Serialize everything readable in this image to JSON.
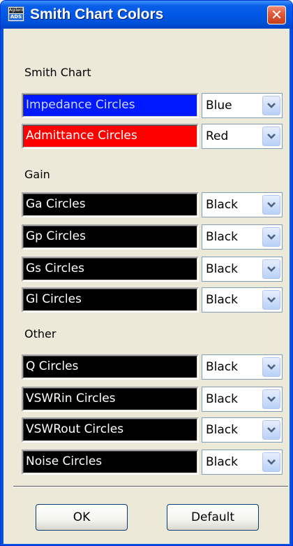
{
  "window": {
    "title": "Smith Chart Colors",
    "icon_top_text": "Agilent",
    "icon_bottom_text": "ADS",
    "close_glyph": "✕"
  },
  "sections": {
    "smith_chart": "Smith Chart",
    "gain": "Gain",
    "other": "Other"
  },
  "rows": [
    {
      "label": "Impedance Circles",
      "value": "Blue",
      "swatch_color": "#0019ff",
      "text_color": "#cfd8ff"
    },
    {
      "label": "Admittance Circles",
      "value": "Red",
      "swatch_color": "#ff0000",
      "text_color": "#ffffff"
    },
    {
      "label": "Ga Circles",
      "value": "Black",
      "swatch_color": "#000000",
      "text_color": "#ffffff"
    },
    {
      "label": "Gp Circles",
      "value": "Black",
      "swatch_color": "#000000",
      "text_color": "#ffffff"
    },
    {
      "label": "Gs Circles",
      "value": "Black",
      "swatch_color": "#000000",
      "text_color": "#ffffff"
    },
    {
      "label": "Gl Circles",
      "value": "Black",
      "swatch_color": "#000000",
      "text_color": "#ffffff"
    },
    {
      "label": "Q Circles",
      "value": "Black",
      "swatch_color": "#000000",
      "text_color": "#ffffff"
    },
    {
      "label": "VSWRin Circles",
      "value": "Black",
      "swatch_color": "#000000",
      "text_color": "#ffffff"
    },
    {
      "label": "VSWRout Circles",
      "value": "Black",
      "swatch_color": "#000000",
      "text_color": "#ffffff"
    },
    {
      "label": "Noise Circles",
      "value": "Black",
      "swatch_color": "#000000",
      "text_color": "#ffffff"
    }
  ],
  "buttons": {
    "ok": "OK",
    "default": "Default"
  },
  "icons": {
    "dropdown": "chevron-down-icon",
    "close": "close-icon",
    "app": "agilent-ads-icon"
  }
}
